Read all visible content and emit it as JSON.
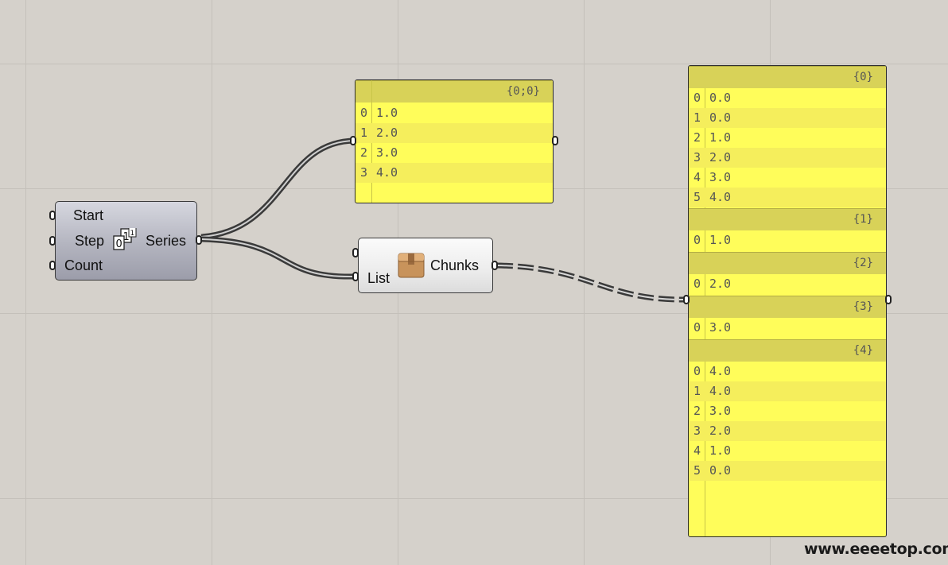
{
  "series_component": {
    "inputs": [
      "Start",
      "Step",
      "Count"
    ],
    "output": "Series",
    "icon": "series-icon"
  },
  "chunks_component": {
    "input": "List",
    "output": "Chunks",
    "icon": "box-icon"
  },
  "panel_top": {
    "branch": "{0;0}",
    "rows": [
      {
        "index": "0",
        "value": "1.0"
      },
      {
        "index": "1",
        "value": "2.0"
      },
      {
        "index": "2",
        "value": "3.0"
      },
      {
        "index": "3",
        "value": "4.0"
      }
    ]
  },
  "panel_right": {
    "branches": [
      {
        "path": "{0}",
        "rows": [
          {
            "index": "0",
            "value": "0.0"
          },
          {
            "index": "1",
            "value": "0.0"
          },
          {
            "index": "2",
            "value": "1.0"
          },
          {
            "index": "3",
            "value": "2.0"
          },
          {
            "index": "4",
            "value": "3.0"
          },
          {
            "index": "5",
            "value": "4.0"
          }
        ]
      },
      {
        "path": "{1}",
        "rows": [
          {
            "index": "0",
            "value": "1.0"
          }
        ]
      },
      {
        "path": "{2}",
        "rows": [
          {
            "index": "0",
            "value": "2.0"
          }
        ]
      },
      {
        "path": "{3}",
        "rows": [
          {
            "index": "0",
            "value": "3.0"
          }
        ]
      },
      {
        "path": "{4}",
        "rows": [
          {
            "index": "0",
            "value": "4.0"
          },
          {
            "index": "1",
            "value": "4.0"
          },
          {
            "index": "2",
            "value": "3.0"
          },
          {
            "index": "3",
            "value": "2.0"
          },
          {
            "index": "4",
            "value": "1.0"
          },
          {
            "index": "5",
            "value": "0.0"
          }
        ]
      }
    ]
  },
  "watermark": "www.eeeetop.com",
  "colors": {
    "canvas": "#d5d1cb",
    "grid": "#c4c0ba",
    "panel": "#fffd5a",
    "panel_branch": "#d8d258",
    "wire": "#444444"
  }
}
